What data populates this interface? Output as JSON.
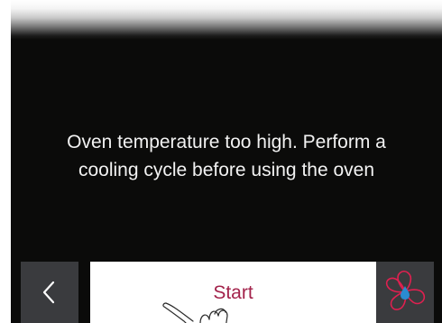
{
  "alert": {
    "line1": "Oven temperature too high. Perform a",
    "line2": "cooling cycle before using the oven"
  },
  "actions": {
    "back_icon": "chevron-left-icon",
    "start_label": "Start",
    "start_hint_icon": "hand-tap-icon",
    "cooling_icon": "fan-water-drop-icon"
  },
  "colors": {
    "screen_background": "#0b0b0a",
    "message_text": "#f2f2f2",
    "side_button": "#3a3b3e",
    "start_button": "#ffffff",
    "accent": "#a3234b",
    "drop_blue": "#2a8bd1"
  }
}
